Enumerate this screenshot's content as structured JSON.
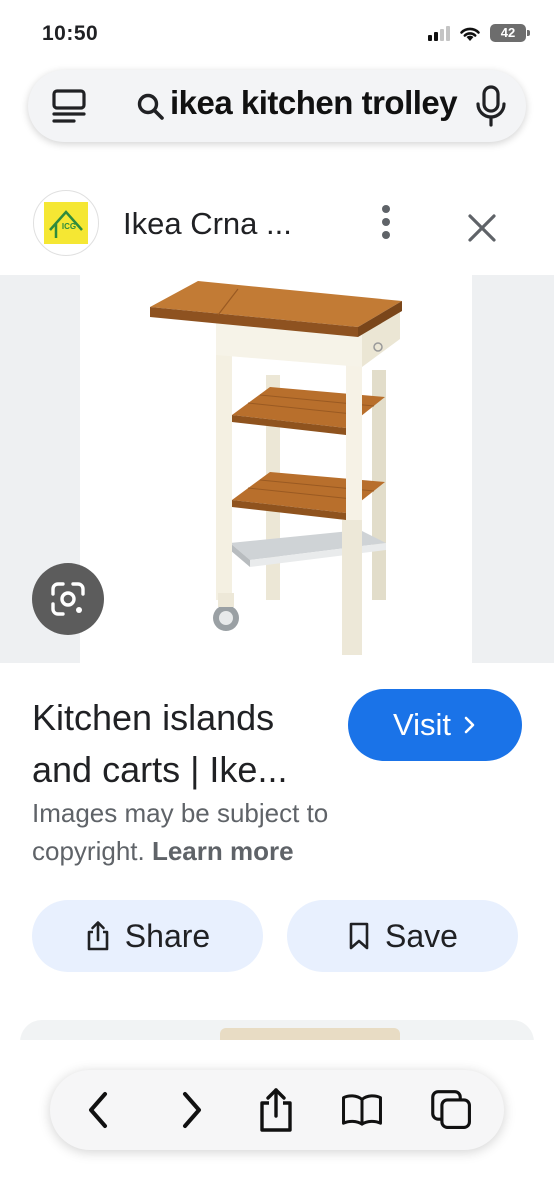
{
  "status_bar": {
    "time": "10:50",
    "battery": "42",
    "icons": [
      "cellular-signal-icon",
      "wifi-icon",
      "battery-icon"
    ]
  },
  "search": {
    "query": "ikea kitchen trolley",
    "icons": [
      "tabs-icon",
      "search-icon",
      "microphone-icon"
    ]
  },
  "source": {
    "name": "Ikea Crna ...",
    "logo_text": "ICG",
    "logo_colors": {
      "background": "#f5e733",
      "accent": "#2e8b3d"
    }
  },
  "result": {
    "title": "Kitchen islands and carts | Ike...",
    "visit_label": "Visit",
    "copyright_text": "Images may be subject to copyright.",
    "learn_more": "Learn more"
  },
  "actions": {
    "share_label": "Share",
    "save_label": "Save"
  },
  "toolbar": {
    "items": [
      "back-icon",
      "forward-icon",
      "share-icon",
      "bookmarks-icon",
      "tabs-overview-icon"
    ]
  },
  "colors": {
    "accent": "#1a73e8",
    "action_button_bg": "#e8f0fe",
    "lens_button_bg": "#5c5c5c"
  }
}
